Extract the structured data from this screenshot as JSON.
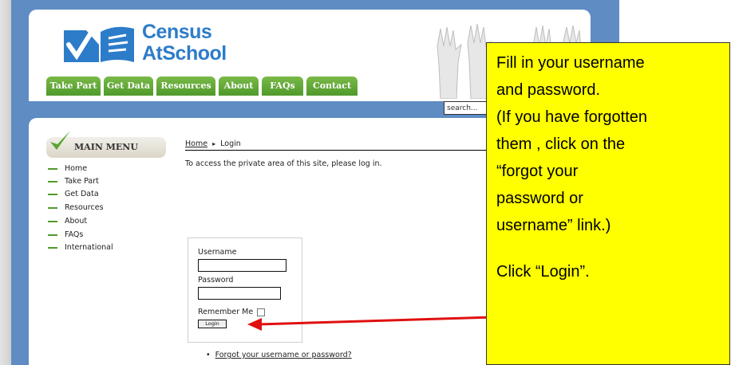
{
  "site": {
    "logo_line1": "Census",
    "logo_line2": "AtSchool",
    "search_placeholder": "search...",
    "nav": [
      "Take Part",
      "Get Data",
      "Resources",
      "About",
      "FAQs",
      "Contact"
    ],
    "colors": {
      "frame": "#5e8cc3",
      "nav_green": "#5aa534",
      "logo_blue": "#2d7cc9"
    }
  },
  "menu": {
    "title": "MAIN MENU",
    "items": [
      "Home",
      "Take Part",
      "Get Data",
      "Resources",
      "About",
      "FAQs",
      "International"
    ]
  },
  "breadcrumb": {
    "home": "Home",
    "separator": "▸",
    "current": "Login"
  },
  "intro": "To access the private area of this site, please log in.",
  "login": {
    "username_label": "Username",
    "username_value": "",
    "password_label": "Password",
    "password_value": "",
    "remember_label": "Remember Me",
    "button_label": "Login",
    "forgot_bullet": "•",
    "forgot_link": "Forgot your username or password?"
  },
  "callout": {
    "lines": [
      "Fill in your username",
      "and password.",
      "(If you have forgotten",
      "them , click on the",
      "“forgot your",
      "password or",
      "username” link.)",
      "Click “Login”."
    ],
    "color": "#ffff00"
  },
  "icons": {
    "logo": "census-logo-icon",
    "check": "green-check-icon",
    "hands": "raised-hands-image",
    "arrow": "red-arrow"
  }
}
